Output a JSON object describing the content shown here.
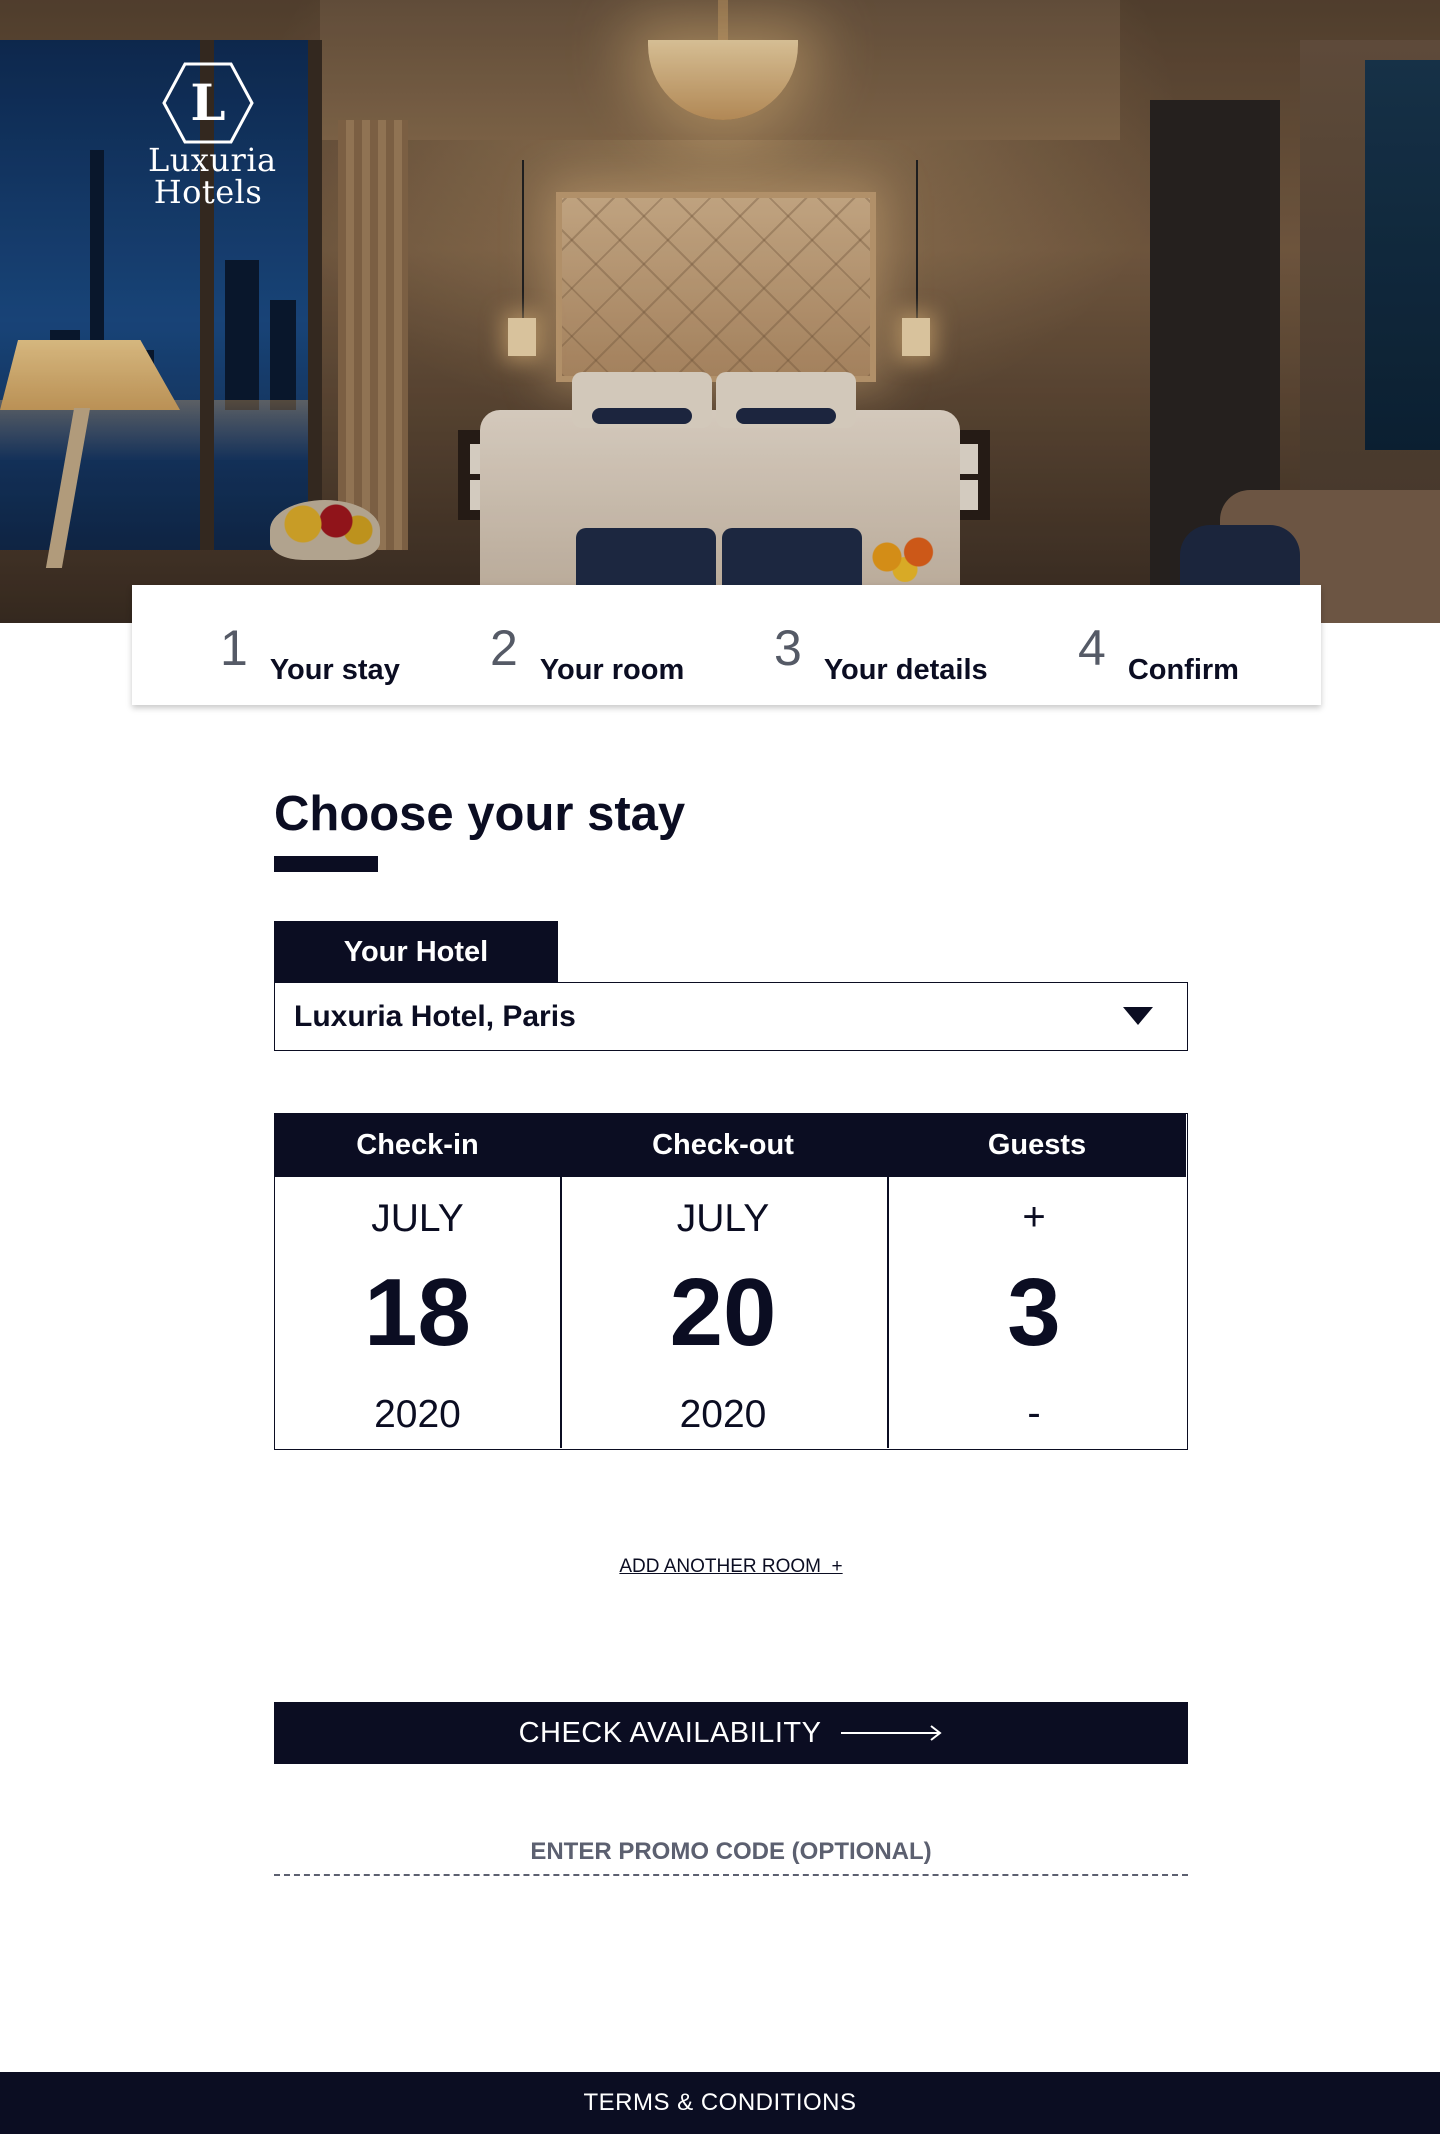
{
  "brand": {
    "logo_letter": "L",
    "line1": "Luxuria",
    "line2": "Hotels"
  },
  "steps": [
    {
      "number": "1",
      "label": "Your stay"
    },
    {
      "number": "2",
      "label": "Your room"
    },
    {
      "number": "3",
      "label": "Your details"
    },
    {
      "number": "4",
      "label": "Confirm"
    }
  ],
  "page_title": "Choose your stay",
  "hotel": {
    "tab_label": "Your Hotel",
    "selected": "Luxuria Hotel, Paris"
  },
  "booking": {
    "headers": {
      "checkin": "Check-in",
      "checkout": "Check-out",
      "guests": "Guests"
    },
    "checkin": {
      "month": "JULY",
      "day": "18",
      "year": "2020"
    },
    "checkout": {
      "month": "JULY",
      "day": "20",
      "year": "2020"
    },
    "guests": {
      "plus": "+",
      "count": "3",
      "minus": "-"
    }
  },
  "add_room": "ADD ANOTHER ROOM  +",
  "cta": "CHECK AVAILABILITY",
  "promo_placeholder": "ENTER PROMO CODE (OPTIONAL)",
  "footer": "TERMS & CONDITIONS",
  "colors": {
    "navy": "#0b0d22",
    "muted": "#5c6070",
    "white": "#ffffff"
  },
  "icons": {
    "logo": "hexagon-logo-icon",
    "caret": "caret-down-icon",
    "arrow": "arrow-right-icon"
  }
}
